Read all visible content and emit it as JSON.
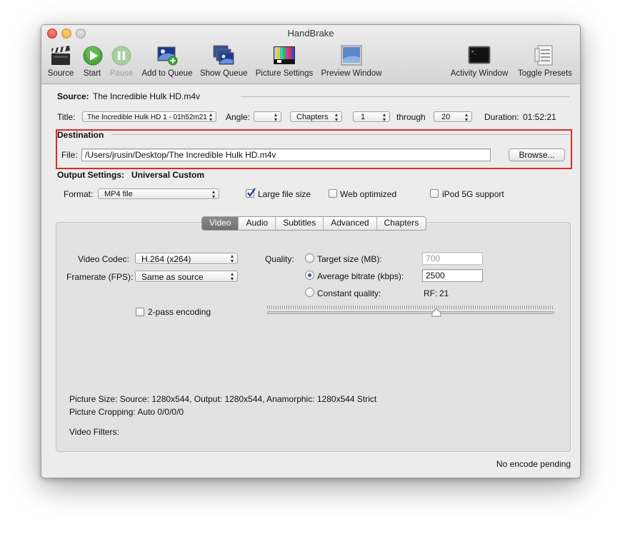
{
  "window": {
    "title": "HandBrake"
  },
  "toolbar": {
    "source": "Source",
    "start": "Start",
    "pause": "Pause",
    "add_to_queue": "Add to Queue",
    "show_queue": "Show Queue",
    "picture_settings": "Picture Settings",
    "preview_window": "Preview Window",
    "activity_window": "Activity Window",
    "toggle_presets": "Toggle Presets"
  },
  "source": {
    "label": "Source:",
    "value": "The Incredible Hulk HD.m4v"
  },
  "title_row": {
    "title_label": "Title:",
    "title_value": "The Incredible Hulk HD 1 - 01h52m21s",
    "angle_label": "Angle:",
    "angle_value": "",
    "range_type": "Chapters",
    "start": "1",
    "through_label": "through",
    "end": "20",
    "duration_label": "Duration:",
    "duration_value": "01:52:21"
  },
  "destination": {
    "heading": "Destination",
    "file_label": "File:",
    "file_value": "/Users/jrusin/Desktop/The Incredible Hulk HD.m4v",
    "browse_label": "Browse..."
  },
  "output_settings": {
    "label": "Output Settings:",
    "preset": "Universal Custom",
    "format_label": "Format:",
    "format_value": "MP4 file",
    "large_file": {
      "label": "Large file size",
      "checked": true
    },
    "web_optimized": {
      "label": "Web optimized",
      "checked": false
    },
    "ipod": {
      "label": "iPod 5G support",
      "checked": false
    }
  },
  "tabs": [
    "Video",
    "Audio",
    "Subtitles",
    "Advanced",
    "Chapters"
  ],
  "video": {
    "codec_label": "Video Codec:",
    "codec_value": "H.264 (x264)",
    "framerate_label": "Framerate (FPS):",
    "framerate_value": "Same as source",
    "two_pass": {
      "label": "2-pass encoding",
      "checked": false
    },
    "quality_label": "Quality:",
    "target_size": {
      "label": "Target size (MB):",
      "value": "700",
      "selected": false
    },
    "avg_bitrate": {
      "label": "Average bitrate (kbps):",
      "value": "2500",
      "selected": true
    },
    "constant_quality": {
      "label": "Constant quality:",
      "selected": false
    },
    "rf_label": "RF:",
    "rf_value": "21",
    "picture_size": "Picture Size: Source: 1280x544, Output: 1280x544, Anamorphic: 1280x544 Strict",
    "picture_cropping": "Picture Cropping: Auto 0/0/0/0",
    "video_filters": "Video Filters:"
  },
  "status": "No encode pending"
}
